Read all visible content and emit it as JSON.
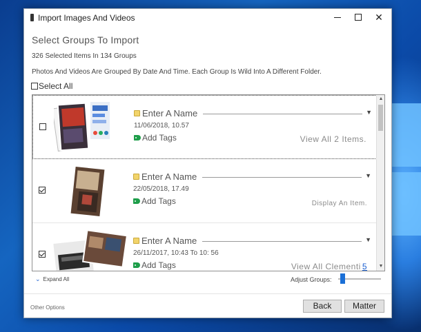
{
  "window": {
    "title": "Import Images And Videos",
    "minimize_icon": "minimize-icon",
    "maximize_icon": "maximize-icon",
    "close_icon": "close-icon",
    "close_glyph": "✕"
  },
  "header": {
    "heading": "Select Groups To Import",
    "count": "326 Selected Items In 134 Groups",
    "description": "Photos And Videos Are Grouped By Date And Time. Each Group Is Wild Into A Different Folder.",
    "select_all_label": "Select All"
  },
  "groups": [
    {
      "checked": false,
      "name": "Enter A Name",
      "date": "11/06/2018, 10.57",
      "tags": "Add Tags",
      "view": "View All 2 Items."
    },
    {
      "checked": true,
      "name": "Enter A Name",
      "date": "22/05/2018, 17.49",
      "tags": "Add Tags",
      "view": "Display An Item."
    },
    {
      "checked": true,
      "name": "Enter A Name",
      "date": "26/11/2017, 10:43 To 10: 56",
      "tags": "Add Tags",
      "view": "View All Clementi",
      "view_count": "5"
    }
  ],
  "footer": {
    "expand_label": "Expand All",
    "adjust_label": "Adjust Groups:",
    "adjust_level": 0.05,
    "other_options": "Other Options",
    "back_label": "Back",
    "next_label": "Matter"
  },
  "colors": {
    "accent": "#1a6fd6",
    "folder": "#f2d46b",
    "tag": "#1e9e4a"
  }
}
